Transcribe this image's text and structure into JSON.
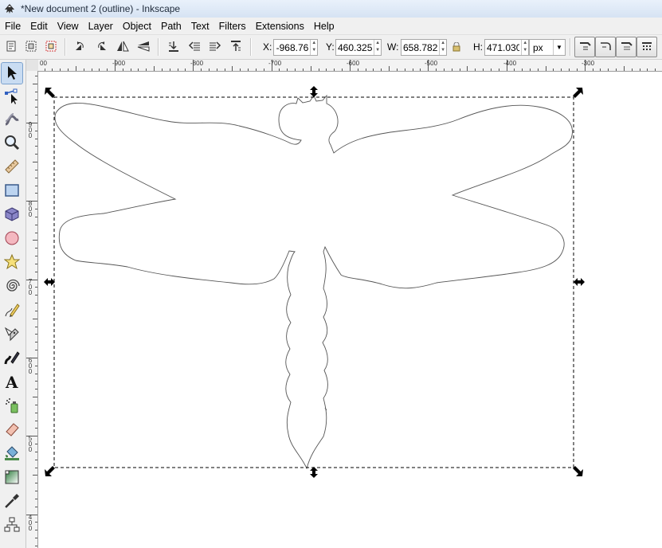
{
  "window": {
    "title": "*New document 2 (outline) - Inkscape",
    "app_icon": "inkscape-icon"
  },
  "menu": {
    "items": [
      {
        "label": "File",
        "name": "menu-file"
      },
      {
        "label": "Edit",
        "name": "menu-edit"
      },
      {
        "label": "View",
        "name": "menu-view"
      },
      {
        "label": "Layer",
        "name": "menu-layer"
      },
      {
        "label": "Object",
        "name": "menu-object"
      },
      {
        "label": "Path",
        "name": "menu-path"
      },
      {
        "label": "Text",
        "name": "menu-text"
      },
      {
        "label": "Filters",
        "name": "menu-filters"
      },
      {
        "label": "Extensions",
        "name": "menu-extensions"
      },
      {
        "label": "Help",
        "name": "menu-help"
      }
    ]
  },
  "controls": {
    "x_label": "X:",
    "x_value": "-968.76",
    "y_label": "Y:",
    "y_value": "460.325",
    "w_label": "W:",
    "w_value": "658.782",
    "h_label": "H:",
    "h_value": "471.030",
    "unit": "px",
    "icons": {
      "select_all": "select-all-icon",
      "select_all_layers": "select-all-in-all-layers-icon",
      "deselect": "deselect-icon",
      "rotate_ccw": "rotate-ccw-icon",
      "rotate_cw": "rotate-cw-icon",
      "flip_h": "flip-horizontal-icon",
      "flip_v": "flip-vertical-icon",
      "lower_bottom": "lower-to-bottom-icon",
      "lower": "lower-icon",
      "raise": "raise-icon",
      "raise_top": "raise-to-top-icon",
      "lock": "lock-icon",
      "scale_stroke": "scale-stroke-icon",
      "scale_corners": "scale-rounded-corners-icon",
      "move_gradients": "move-gradients-icon",
      "move_patterns": "move-patterns-icon"
    }
  },
  "toolbox": {
    "tools": [
      {
        "name": "selector-tool-icon",
        "active": true
      },
      {
        "name": "node-tool-icon",
        "active": false
      },
      {
        "name": "tweak-tool-icon",
        "active": false
      },
      {
        "name": "zoom-tool-icon",
        "active": false
      },
      {
        "name": "measure-tool-icon",
        "active": false
      },
      {
        "name": "rectangle-tool-icon",
        "active": false
      },
      {
        "name": "3d-box-tool-icon",
        "active": false
      },
      {
        "name": "ellipse-tool-icon",
        "active": false
      },
      {
        "name": "star-tool-icon",
        "active": false
      },
      {
        "name": "spiral-tool-icon",
        "active": false
      },
      {
        "name": "pencil-tool-icon",
        "active": false
      },
      {
        "name": "pen-tool-icon",
        "active": false
      },
      {
        "name": "calligraphy-tool-icon",
        "active": false
      },
      {
        "name": "text-tool-icon",
        "active": false
      },
      {
        "name": "spray-tool-icon",
        "active": false
      },
      {
        "name": "eraser-tool-icon",
        "active": false
      },
      {
        "name": "paint-bucket-tool-icon",
        "active": false
      },
      {
        "name": "gradient-tool-icon",
        "active": false
      },
      {
        "name": "dropper-tool-icon",
        "active": false
      },
      {
        "name": "connector-tool-icon",
        "active": false
      }
    ]
  },
  "rulers": {
    "horizontal_labels": [
      "00",
      "-900",
      "-800",
      "-700",
      "-600",
      "-500",
      "-400",
      "-300"
    ],
    "vertical_labels": [
      "900",
      "800",
      "700",
      "600",
      "500",
      "400"
    ]
  },
  "canvas": {
    "view_mode": "outline",
    "selection": "dragonfly-outline-path",
    "colors": {
      "outline": "#555555",
      "bbox": "#000000"
    }
  }
}
